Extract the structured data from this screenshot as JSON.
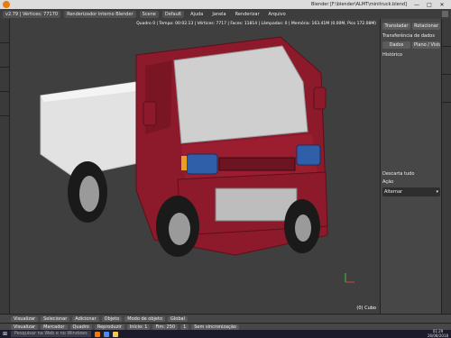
{
  "window": {
    "title": "Blender [F:\\blender\\ALMT\\minitruck.blend]",
    "minimize": "—",
    "maximize": "□",
    "close": "✕"
  },
  "menubar": {
    "items": [
      "Arquivo",
      "Renderizar",
      "Janela",
      "Ajuda"
    ],
    "layout": "Default",
    "scene": "Scene",
    "engine": "Renderizador interno Blender",
    "version": "v2.79 | Vértices: 77170"
  },
  "viewport": {
    "info": "Quadro 0 | Tempo: 00:02.13 | Vértices: 7717 | Faces: 11814 | Lâmpadas: 0 | Memória: 163.41M (0.00M, Pico 172.08M)",
    "object_name": "(0) Cubo"
  },
  "right_panel": {
    "btn_translate": "Transladar",
    "btn_rotate": "Rotacionar",
    "label_transform": "Transferência de dados",
    "btn_data": "Dados",
    "btn_layout": "Plano / Vistas",
    "label_history": "Histórico",
    "label_delete": "Descarta tudo",
    "label_action": "Ação",
    "select_value": "Alternar"
  },
  "view_header": {
    "items": [
      "Visualizar",
      "Selecionar",
      "Adicionar",
      "Objeto",
      "Modo de objeto",
      "Global"
    ]
  },
  "timeline": {
    "items": [
      "Visualizar",
      "Marcador",
      "Quadro",
      "Reproduzir"
    ],
    "start": "Início: 1",
    "end": "Fim: 250",
    "current": "1",
    "sync": "Sem sincronização"
  },
  "taskbar": {
    "search_placeholder": "Pesquisar na Web e no Windows",
    "time": "01:29",
    "date": "26/08/2018"
  },
  "colors": {
    "truck_body": "#8c1a2a",
    "truck_glass": "#c8c8c8",
    "headlight": "#2f5fa8",
    "blinker": "#e8a020",
    "bed": "#e2e2e2",
    "tire": "#1a1a1a"
  }
}
